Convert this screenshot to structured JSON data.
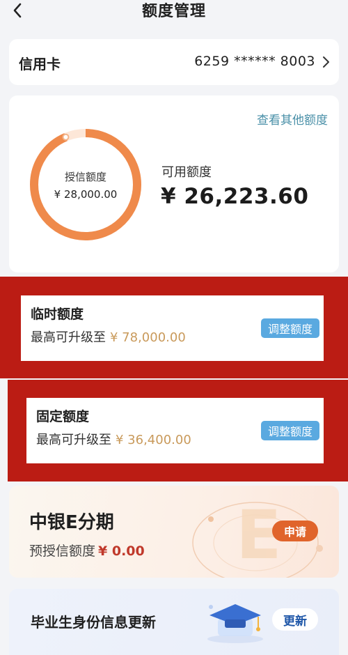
{
  "header": {
    "title": "额度管理",
    "back_icon": "chevron-left-icon"
  },
  "card_selector": {
    "label": "信用卡",
    "card_number": "6259 ****** 8003",
    "chevron_icon": "chevron-right-icon"
  },
  "overview": {
    "link_other": "查看其他额度",
    "ring_label": "授信额度",
    "ring_value": "¥ 28,000.00",
    "ring_used_fraction": 0.063,
    "available_label": "可用额度",
    "available_amount": "¥ 26,223.60",
    "ring_color": "#ef8a4b"
  },
  "temporary": {
    "title": "临时额度",
    "line_prefix": "最高可升级至",
    "amount": "¥ 78,000.00",
    "button": "调整额度"
  },
  "fixed": {
    "title": "固定额度",
    "line_prefix": "最高可升级至",
    "amount": "¥ 36,400.00",
    "button": "调整额度"
  },
  "installment": {
    "title": "中银E分期",
    "line_prefix": "预授信额度",
    "amount": "¥ 0.00",
    "button": "申请",
    "deco_letter": "E"
  },
  "graduate": {
    "title": "毕业生身份信息更新",
    "button": "更新",
    "deco_icon": "graduation-cap-icon"
  },
  "colors": {
    "highlight_red": "#bb1c14",
    "adjust_blue": "#5aa9e0",
    "apply_orange": "#e0642b",
    "gold": "#c99a5b"
  }
}
